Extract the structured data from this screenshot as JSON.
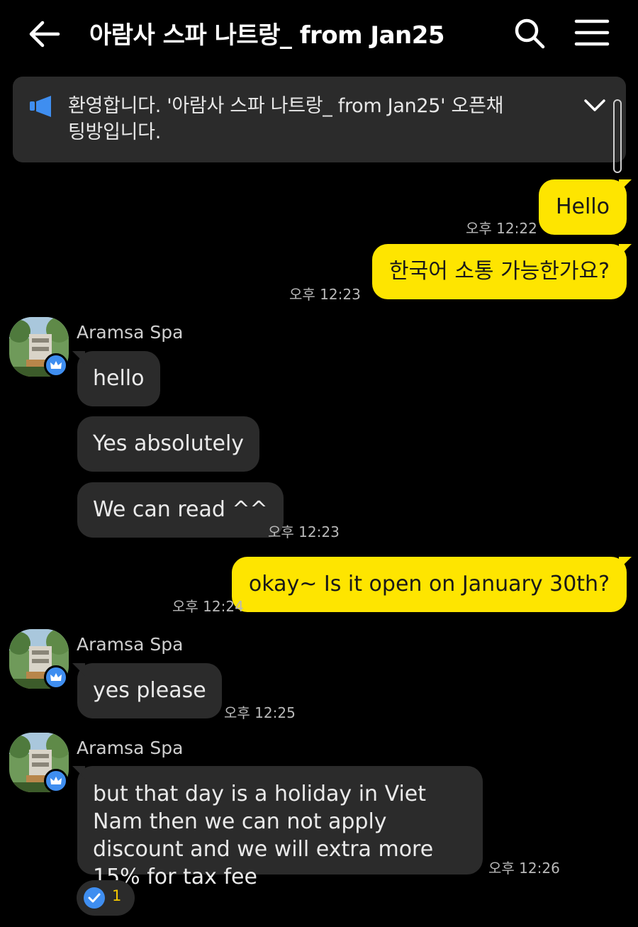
{
  "header": {
    "title": "아람사 스파 나트랑_ from Jan25",
    "back_icon": "arrow-left-icon",
    "search_icon": "search-icon",
    "menu_icon": "hamburger-menu-icon"
  },
  "notice": {
    "icon": "megaphone-icon",
    "text": "환영합니다. '아람사 스파 나트랑_ from Jan25' 오픈채팅방입니다.",
    "expand_icon": "chevron-down-icon",
    "accent_color": "#3f8ef0"
  },
  "messages": {
    "m1": {
      "text": "Hello",
      "time": "오후 12:22"
    },
    "m2": {
      "text": "한국어 소통 가능한가요?",
      "time": "오후 12:23"
    },
    "g1": {
      "sender": "Aramsa Spa",
      "m1": "hello",
      "m2": "Yes absolutely",
      "m3": "We can read ^^",
      "time": "오후 12:23"
    },
    "m3": {
      "text": "okay~ Is it open on January 30th?",
      "time": "오후 12:24"
    },
    "g2": {
      "sender": "Aramsa Spa",
      "text": "yes please",
      "time": "오후 12:25"
    },
    "g3": {
      "sender": "Aramsa Spa",
      "text": "but that day is a holiday in Viet Nam then we can not apply discount and we will extra more 15% for tax fee",
      "time": "오후 12:26"
    }
  },
  "reaction": {
    "icon": "check-circle-icon",
    "count": "1"
  },
  "colors": {
    "my_bubble": "#fee500",
    "their_bubble": "#2b2b2b",
    "background": "#000000",
    "host_badge": "#3f8ef0"
  }
}
